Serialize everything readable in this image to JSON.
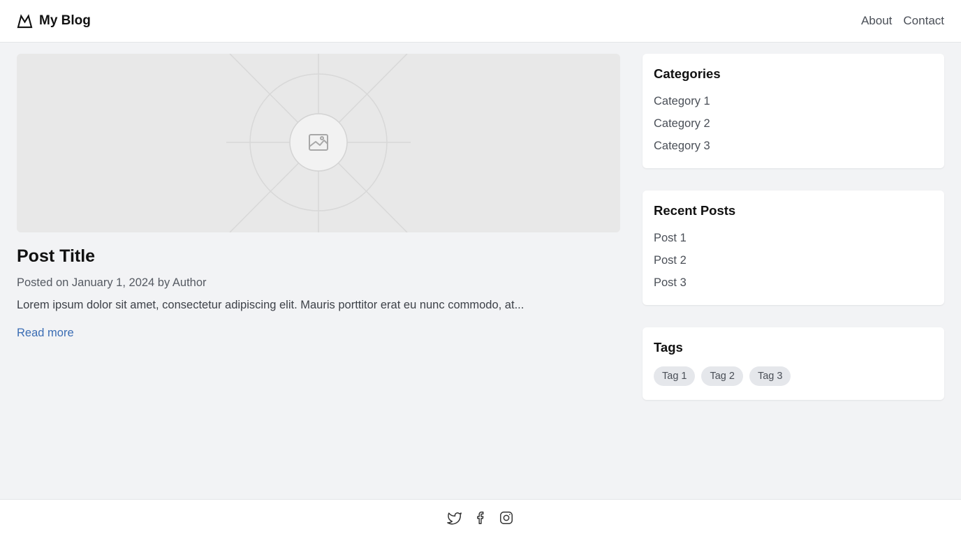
{
  "header": {
    "brand": "My Blog",
    "brand_icon": "mountain-logo-icon",
    "nav": [
      {
        "label": "About"
      },
      {
        "label": "Contact"
      }
    ]
  },
  "post": {
    "image_icon": "image-placeholder-icon",
    "title": "Post Title",
    "meta": "Posted on January 1, 2024 by Author",
    "excerpt": "Lorem ipsum dolor sit amet, consectetur adipiscing elit. Mauris porttitor erat eu nunc commodo, at...",
    "read_more": "Read more",
    "link_color": "#3b6db4"
  },
  "sidebar": {
    "categories": {
      "title": "Categories",
      "items": [
        {
          "label": "Category 1"
        },
        {
          "label": "Category 2"
        },
        {
          "label": "Category 3"
        }
      ]
    },
    "recent": {
      "title": "Recent Posts",
      "items": [
        {
          "label": "Post 1"
        },
        {
          "label": "Post 2"
        },
        {
          "label": "Post 3"
        }
      ]
    },
    "tags": {
      "title": "Tags",
      "items": [
        {
          "label": "Tag 1"
        },
        {
          "label": "Tag 2"
        },
        {
          "label": "Tag 3"
        }
      ]
    }
  },
  "footer": {
    "social": [
      "twitter-icon",
      "facebook-icon",
      "instagram-icon"
    ]
  }
}
